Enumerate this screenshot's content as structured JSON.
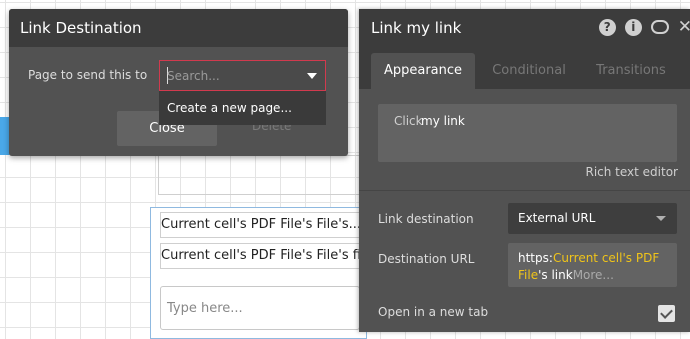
{
  "canvas": {
    "cells": [
      "Current cell's PDF File's File's...",
      "Current cell's PDF File's File's fi..."
    ],
    "input_placeholder": "Type here..."
  },
  "link_destination": {
    "title": "Link Destination",
    "field_label": "Page to send this to",
    "select_placeholder": "Search...",
    "dropdown_option": "Create a new page...",
    "close_label": "Close",
    "delete_label": "Delete"
  },
  "panel": {
    "title": "Link my link",
    "tabs": [
      "Appearance",
      "Conditional",
      "Transitions"
    ],
    "editor_part1": "Click",
    "editor_part2": "my link",
    "rich_text_label": "Rich text editor",
    "link_destination_label": "Link destination",
    "link_destination_value": "External URL",
    "destination_url_label": "Destination URL",
    "url_prefix": "https:",
    "url_dynamic1": "Current cell's PDF",
    "url_dynamic2": "File",
    "url_suffix": "'s link",
    "url_more": "More...",
    "open_new_tab_label": "Open in a new tab"
  },
  "colors": {
    "accent": "#d13a4e",
    "dynamic_text": "#f0c419",
    "selection": "#4aa8e8"
  },
  "icons": [
    "help-icon",
    "info-icon",
    "comment-icon",
    "close-icon"
  ]
}
